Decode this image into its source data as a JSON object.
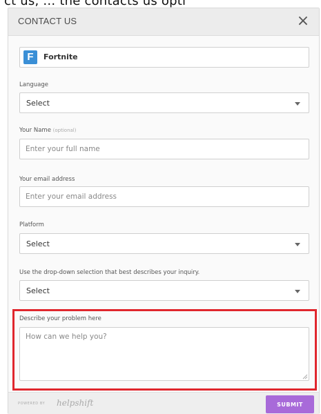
{
  "top_strip_text": "ct us, … the contacts us opti",
  "header": {
    "title": "CONTACT US",
    "close_glyph": "×"
  },
  "app": {
    "logo_letter": "F",
    "name": "Fortnite",
    "logo_color": "#3a8fd6"
  },
  "fields": {
    "language": {
      "label": "Language",
      "value": "Select"
    },
    "name": {
      "label": "Your Name",
      "optional": "(optional)",
      "placeholder": "Enter your full name"
    },
    "email": {
      "label": "Your email address",
      "placeholder": "Enter your email address"
    },
    "platform": {
      "label": "Platform",
      "value": "Select"
    },
    "inquiry": {
      "label": "Use the drop-down selection that best describes your inquiry.",
      "value": "Select"
    },
    "problem": {
      "label": "Describe your problem here",
      "placeholder": "How can we help you?"
    }
  },
  "footer": {
    "powered_by": "POWERED BY",
    "brand": "helpshift",
    "submit_label": "SUBMIT"
  },
  "colors": {
    "highlight": "#e0262d",
    "submit": "#a86ad9"
  }
}
